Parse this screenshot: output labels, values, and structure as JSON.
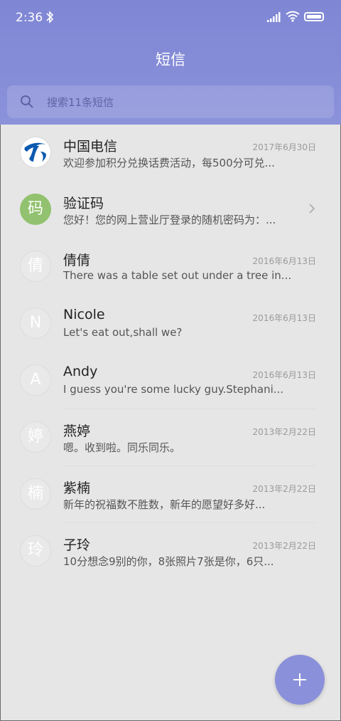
{
  "status_bar": {
    "time": "2:36",
    "icons": [
      "bluetooth-icon",
      "signal-icon",
      "wifi-icon",
      "battery-icon"
    ]
  },
  "header": {
    "title": "短信"
  },
  "search": {
    "placeholder": "搜索11条短信",
    "icon": "search-icon"
  },
  "colors": {
    "header": "#8289d6",
    "fab": "#8a90d9",
    "green_avatar": "#92c26f"
  },
  "conversations": [
    {
      "name": "中国电信",
      "avatar": "telecom-logo",
      "date": "2017年6月30日",
      "preview": "欢迎参加积分兑换话费活动，每500分可兑..."
    },
    {
      "name": "验证码",
      "avatar": "码",
      "date": "",
      "preview": "您好！您的网上营业厅登录的随机密码为：..."
    },
    {
      "name": "倩倩",
      "avatar": "倩",
      "date": "2016年6月13日",
      "preview": "There was a table set out under a tree in..."
    },
    {
      "name": "Nicole",
      "avatar": "N",
      "date": "2016年6月13日",
      "preview": "Let's eat out,shall we?"
    },
    {
      "name": "Andy",
      "avatar": "A",
      "date": "2016年6月13日",
      "preview": "I guess you're some lucky guy.Stephani..."
    },
    {
      "name": "燕婷",
      "avatar": "婷",
      "date": "2013年2月22日",
      "preview": "嗯。收到啦。同乐同乐。"
    },
    {
      "name": "紫楠",
      "avatar": "楠",
      "date": "2013年2月22日",
      "preview": "新年的祝福数不胜数，新年的愿望好多好..."
    },
    {
      "name": "子玲",
      "avatar": "玲",
      "date": "2013年2月22日",
      "preview": "10分想念9别的你，8张照片7张是你，6只..."
    }
  ],
  "fab": {
    "icon": "plus-icon"
  }
}
